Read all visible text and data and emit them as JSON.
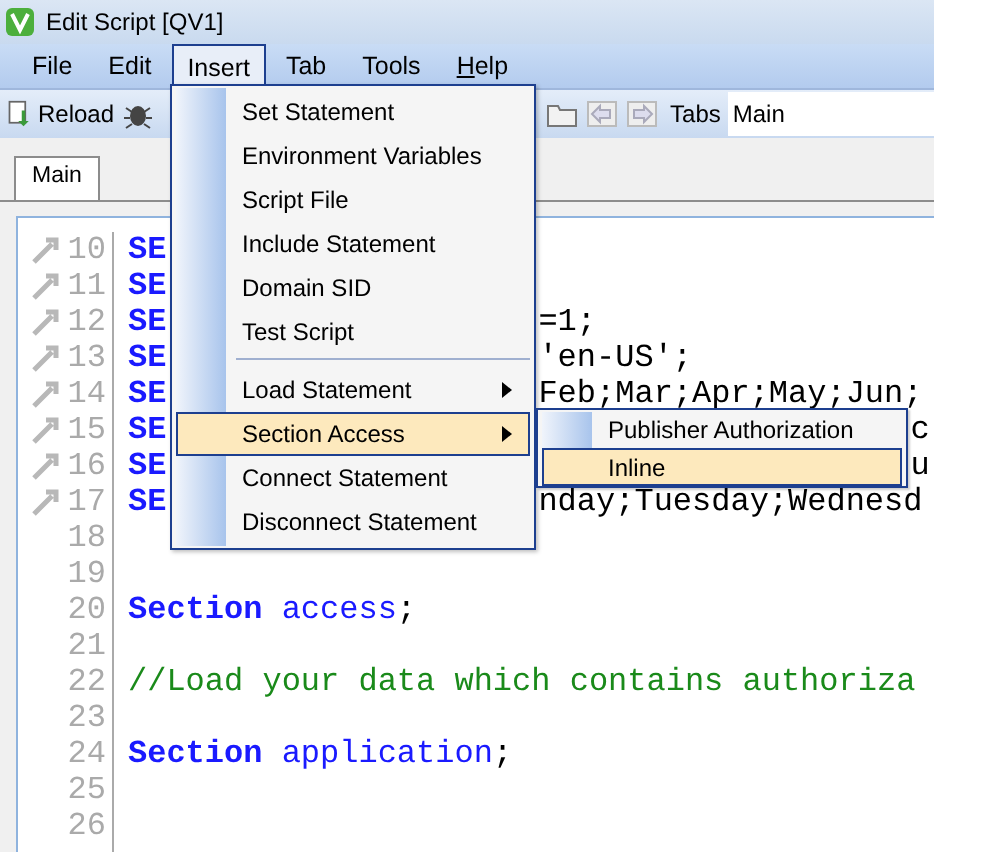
{
  "window": {
    "title": "Edit Script [QV1]"
  },
  "menubar": [
    {
      "label": "File",
      "selected": false,
      "underline_first": false
    },
    {
      "label": "Edit",
      "selected": false,
      "underline_first": false
    },
    {
      "label": "Insert",
      "selected": true,
      "underline_first": false
    },
    {
      "label": "Tab",
      "selected": false,
      "underline_first": false
    },
    {
      "label": "Tools",
      "selected": false,
      "underline_first": false
    },
    {
      "label": "Help",
      "selected": false,
      "underline_first": true
    }
  ],
  "toolbar": {
    "reload": "Reload",
    "tabs_label": "Tabs",
    "tabs_value": "Main"
  },
  "tabs": [
    {
      "label": "Main",
      "selected": true
    }
  ],
  "editor": {
    "lines": [
      {
        "number": "10",
        "marker": true,
        "code": [
          {
            "kind": "keyword",
            "text": "SE"
          }
        ]
      },
      {
        "number": "11",
        "marker": true,
        "code": [
          {
            "kind": "keyword",
            "text": "SE"
          }
        ]
      },
      {
        "number": "12",
        "marker": true,
        "code": [
          {
            "kind": "keyword",
            "text": "SE"
          }
        ],
        "tail": "=1;"
      },
      {
        "number": "13",
        "marker": true,
        "code": [
          {
            "kind": "keyword",
            "text": "SE"
          }
        ],
        "tail": "'en-US';"
      },
      {
        "number": "14",
        "marker": true,
        "code": [
          {
            "kind": "keyword",
            "text": "SE"
          }
        ],
        "tail": "Feb;Mar;Apr;May;Jun;"
      },
      {
        "number": "15",
        "marker": true,
        "code": [
          {
            "kind": "keyword",
            "text": "SE"
          }
        ],
        "far_tail": "c"
      },
      {
        "number": "16",
        "marker": true,
        "code": [
          {
            "kind": "keyword",
            "text": "SE"
          }
        ],
        "far_tail": "u"
      },
      {
        "number": "17",
        "marker": true,
        "code": [
          {
            "kind": "keyword",
            "text": "SE"
          }
        ],
        "tail": "nday;Tuesday;Wednesd"
      },
      {
        "number": "18",
        "marker": false
      },
      {
        "number": "19",
        "marker": false
      },
      {
        "number": "20",
        "marker": false,
        "code": [
          {
            "kind": "keyword",
            "text": "Section "
          },
          {
            "kind": "identifier",
            "text": "access"
          },
          {
            "kind": "plain",
            "text": ";"
          }
        ]
      },
      {
        "number": "21",
        "marker": false
      },
      {
        "number": "22",
        "marker": false,
        "code": [
          {
            "kind": "comment",
            "text": "//Load your data which contains authoriza"
          }
        ]
      },
      {
        "number": "23",
        "marker": false
      },
      {
        "number": "24",
        "marker": false,
        "code": [
          {
            "kind": "keyword",
            "text": "Section "
          },
          {
            "kind": "identifier",
            "text": "application"
          },
          {
            "kind": "plain",
            "text": ";"
          }
        ]
      },
      {
        "number": "25",
        "marker": false
      },
      {
        "number": "26",
        "marker": false
      }
    ]
  },
  "insert_menu": [
    {
      "kind": "item",
      "label": "Set Statement",
      "submenu": false,
      "selected": false
    },
    {
      "kind": "item",
      "label": "Environment Variables",
      "submenu": false,
      "selected": false
    },
    {
      "kind": "item",
      "label": "Script File",
      "submenu": false,
      "selected": false
    },
    {
      "kind": "item",
      "label": "Include Statement",
      "submenu": false,
      "selected": false
    },
    {
      "kind": "item",
      "label": "Domain SID",
      "submenu": false,
      "selected": false
    },
    {
      "kind": "item",
      "label": "Test Script",
      "submenu": false,
      "selected": false
    },
    {
      "kind": "separator"
    },
    {
      "kind": "item",
      "label": "Load Statement",
      "submenu": true,
      "selected": false
    },
    {
      "kind": "item",
      "label": "Section Access",
      "submenu": true,
      "selected": true
    },
    {
      "kind": "item",
      "label": "Connect Statement",
      "submenu": false,
      "selected": false
    },
    {
      "kind": "item",
      "label": "Disconnect Statement",
      "submenu": false,
      "selected": false
    }
  ],
  "section_access_submenu": [
    {
      "label": "Publisher Authorization",
      "selected": false
    },
    {
      "label": "Inline",
      "selected": true
    }
  ]
}
